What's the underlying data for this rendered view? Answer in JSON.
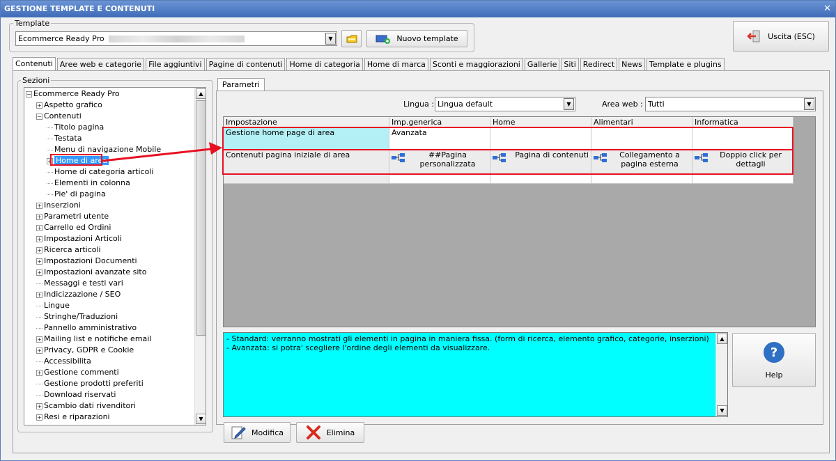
{
  "window": {
    "title": "GESTIONE TEMPLATE E CONTENUTI",
    "close": "✕"
  },
  "template": {
    "group_label": "Template",
    "selected": "Ecommerce Ready Pro",
    "new_button": "Nuovo template",
    "exit_button": "Uscita (ESC)"
  },
  "tabs": [
    "Contenuti",
    "Aree web e categorie",
    "File aggiuntivi",
    "Pagine di contenuti",
    "Home di categoria",
    "Home di marca",
    "Sconti e maggiorazioni",
    "Gallerie",
    "Siti",
    "Redirect",
    "News",
    "Template e plugins"
  ],
  "sections": {
    "label": "Sezioni",
    "tree": [
      {
        "label": "Ecommerce Ready Pro",
        "exp": "−",
        "level": 0
      },
      {
        "label": "Aspetto grafico",
        "exp": "+",
        "level": 1
      },
      {
        "label": "Contenuti",
        "exp": "−",
        "level": 1
      },
      {
        "label": "Titolo pagina",
        "exp": "",
        "level": 2
      },
      {
        "label": "Testata",
        "exp": "",
        "level": 2
      },
      {
        "label": "Menu di navigazione Mobile",
        "exp": "",
        "level": 2
      },
      {
        "label": "Home di area",
        "exp": "+",
        "level": 2,
        "selected": true
      },
      {
        "label": "Home di categoria articoli",
        "exp": "",
        "level": 2
      },
      {
        "label": "Elementi in colonna",
        "exp": "",
        "level": 2
      },
      {
        "label": "Pie' di pagina",
        "exp": "",
        "level": 2
      },
      {
        "label": "Inserzioni",
        "exp": "+",
        "level": 1
      },
      {
        "label": "Parametri utente",
        "exp": "+",
        "level": 1
      },
      {
        "label": "Carrello ed Ordini",
        "exp": "+",
        "level": 1
      },
      {
        "label": "Impostazioni Articoli",
        "exp": "+",
        "level": 1
      },
      {
        "label": "Ricerca articoli",
        "exp": "+",
        "level": 1
      },
      {
        "label": "Impostazioni Documenti",
        "exp": "+",
        "level": 1
      },
      {
        "label": "Impostazioni avanzate sito",
        "exp": "+",
        "level": 1
      },
      {
        "label": "Messaggi e testi vari",
        "exp": "",
        "level": 1
      },
      {
        "label": "Indicizzazione / SEO",
        "exp": "+",
        "level": 1
      },
      {
        "label": "Lingue",
        "exp": "",
        "level": 1
      },
      {
        "label": "Stringhe/Traduzioni",
        "exp": "",
        "level": 1
      },
      {
        "label": "Pannello amministrativo",
        "exp": "",
        "level": 1
      },
      {
        "label": "Mailing list e notifiche email",
        "exp": "+",
        "level": 1
      },
      {
        "label": "Privacy, GDPR e Cookie",
        "exp": "+",
        "level": 1
      },
      {
        "label": "Accessibilita",
        "exp": "",
        "level": 1
      },
      {
        "label": "Gestione commenti",
        "exp": "+",
        "level": 1
      },
      {
        "label": "Gestione prodotti preferiti",
        "exp": "",
        "level": 1
      },
      {
        "label": "Download riservati",
        "exp": "",
        "level": 1
      },
      {
        "label": "Scambio dati rivenditori",
        "exp": "+",
        "level": 1
      },
      {
        "label": "Resi e riparazioni",
        "exp": "+",
        "level": 1
      }
    ]
  },
  "params": {
    "tab": "Parametri",
    "lingua_label": "Lingua :",
    "lingua_value": "Lingua default",
    "area_label": "Area web :",
    "area_value": "Tutti"
  },
  "grid": {
    "headers": [
      "Impostazione",
      "Imp.generica",
      "Home",
      "Alimentari",
      "Informatica"
    ],
    "row1": [
      "Gestione home page di area",
      "Avanzata",
      "",
      "",
      ""
    ],
    "row2": [
      "Contenuti pagina iniziale di area",
      "##Pagina personalizzata",
      "Pagina di contenuti",
      "Collegamento a pagina esterna",
      "Doppio click per dettagli"
    ]
  },
  "description": {
    "line1": "- Standard: verranno mostrati gli elementi in pagina in maniera fissa. (form di ricerca, elemento grafico, categorie, inserzioni)",
    "line2": "- Avanzata: si potra' scegliere l'ordine degli elementi da visualizzare."
  },
  "buttons": {
    "help": "Help",
    "modify": "Modifica",
    "delete": "Elimina"
  },
  "colors": {
    "highlight": "#e81123",
    "cyan": "#00ffff",
    "row1_cell": "#b3f0f5",
    "selection": "#3399ff"
  }
}
